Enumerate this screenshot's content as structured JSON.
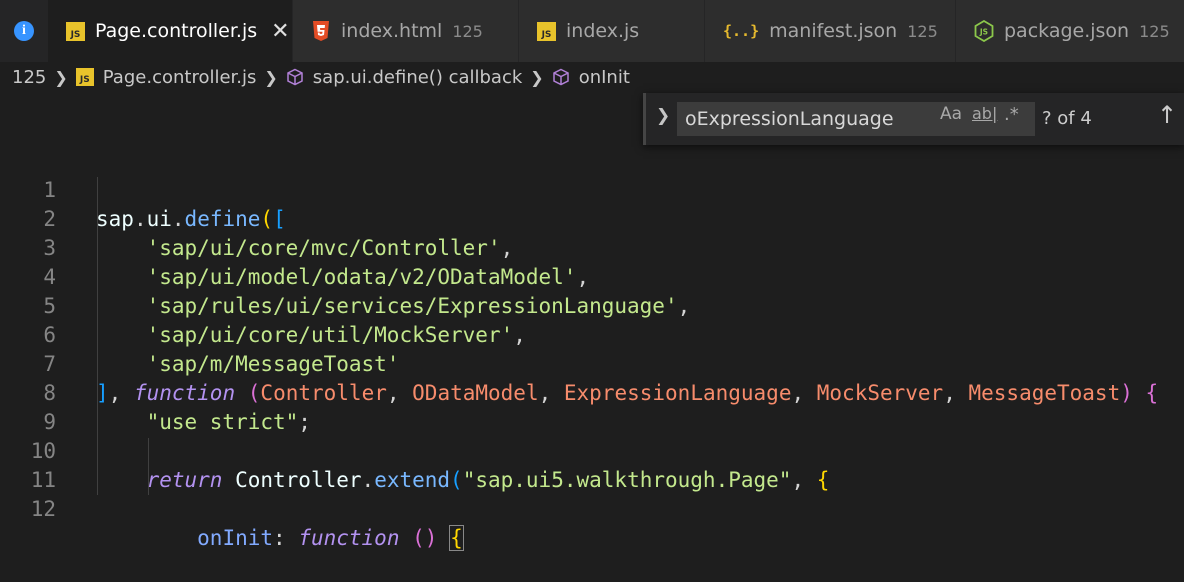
{
  "tabs": [
    {
      "name": "Page.controller.js",
      "count": "",
      "icon": "js-icon",
      "active": true
    },
    {
      "name": "index.html",
      "count": "125",
      "icon": "html5-icon",
      "active": false
    },
    {
      "name": "index.js",
      "count": "",
      "icon": "js-icon",
      "active": false
    },
    {
      "name": "manifest.json",
      "count": "125",
      "icon": "json-braces-icon",
      "active": false
    },
    {
      "name": "package.json",
      "count": "125",
      "icon": "nodejs-icon",
      "active": false
    }
  ],
  "tab_close_glyph": "✕",
  "breadcrumb": {
    "count": "125",
    "file": "Page.controller.js",
    "symbol1": "sap.ui.define() callback",
    "symbol2": "onInit"
  },
  "find": {
    "query": "oExpressionLanguage",
    "match_case": "Aa",
    "whole_word": "ab|",
    "regex": ".*",
    "result": "? of 4"
  },
  "editor": {
    "line_numbers": [
      "1",
      "2",
      "3",
      "4",
      "5",
      "6",
      "7",
      "8",
      "9",
      "10",
      "11",
      "12"
    ],
    "lines": {
      "l1_sap": "sap",
      "l1_ui": "ui",
      "l1_define": "define",
      "l2": "'sap/ui/core/mvc/Controller'",
      "l3": "'sap/ui/model/odata/v2/ODataModel'",
      "l4": "'sap/rules/ui/services/ExpressionLanguage'",
      "l5": "'sap/ui/core/util/MockServer'",
      "l6": "'sap/m/MessageToast'",
      "l7_kw": "function",
      "l7_p1": "Controller",
      "l7_p2": "ODataModel",
      "l7_p3": "ExpressionLanguage",
      "l7_p4": "MockServer",
      "l7_p5": "MessageToast",
      "l8": "\"use strict\"",
      "l10_kw": "return",
      "l10_obj": "Controller",
      "l10_fn": "extend",
      "l10_str": "\"sap.ui5.walkthrough.Page\"",
      "l12_prop": "onInit",
      "l12_kw": "function"
    }
  }
}
